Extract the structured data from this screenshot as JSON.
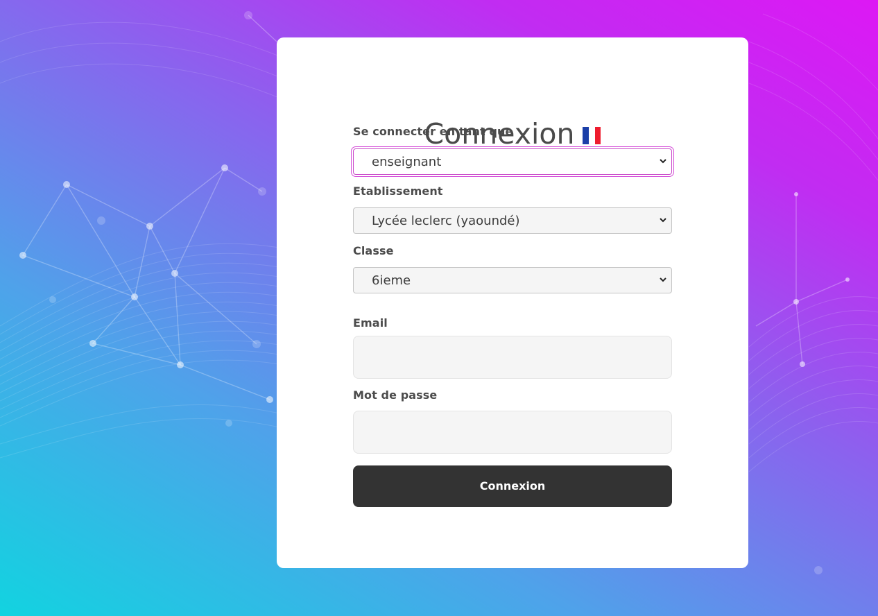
{
  "login": {
    "title": "Connexion",
    "flag_icon": "france-flag-icon",
    "role": {
      "label": "Se connecter en tant que",
      "selected": "enseignant"
    },
    "school": {
      "label": "Etablissement",
      "selected": "Lycée leclerc (yaoundé)"
    },
    "class": {
      "label": "Classe",
      "selected": "6ieme"
    },
    "email": {
      "label": "Email",
      "value": ""
    },
    "password": {
      "label": "Mot de passe",
      "value": ""
    },
    "submit_label": "Connexion"
  },
  "colors": {
    "gradient_start": "#12d3e0",
    "gradient_end": "#dd18f4",
    "button_bg": "#333333",
    "focus_ring": "#d44ad8",
    "flag_blue": "#1b3fa8",
    "flag_red": "#ee1c2e"
  }
}
